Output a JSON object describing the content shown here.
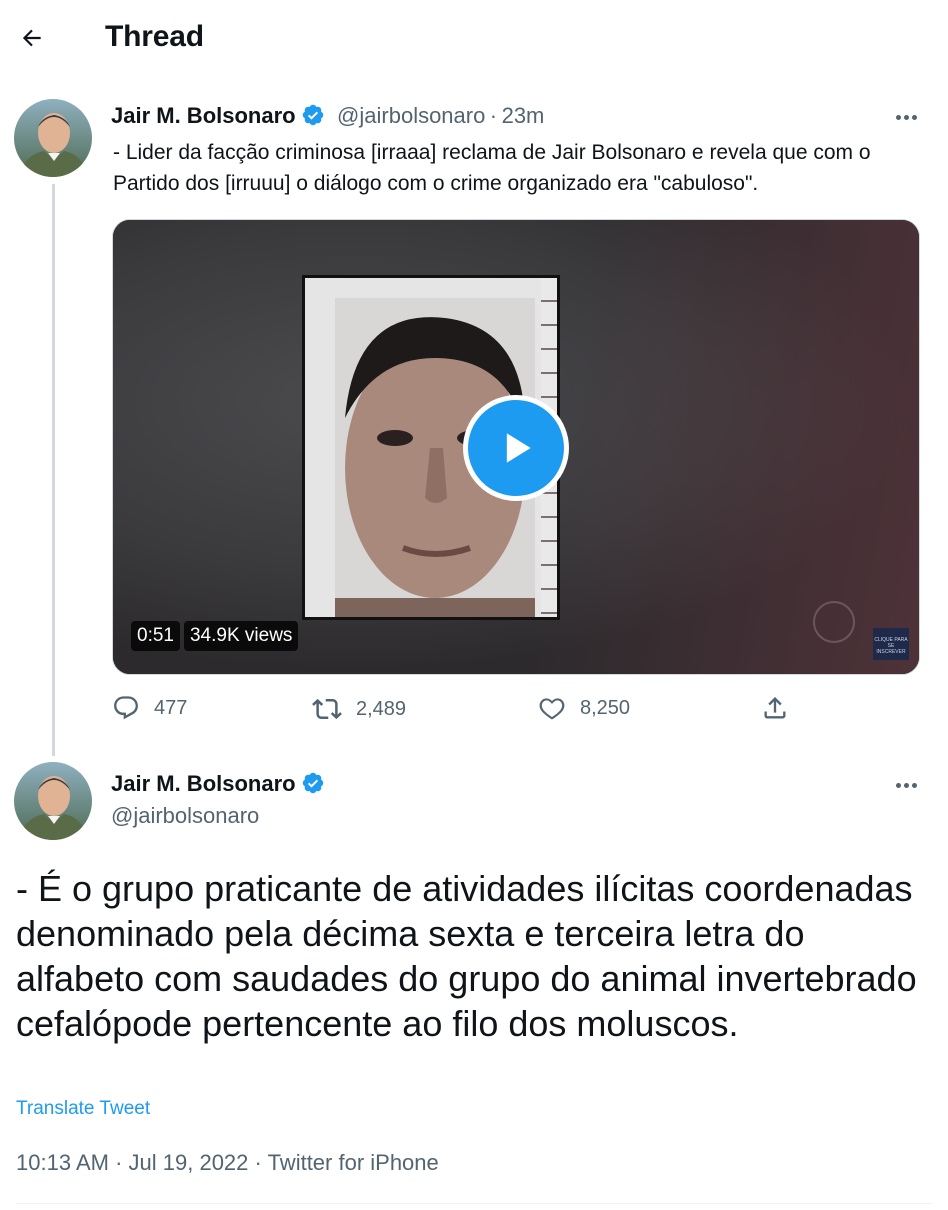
{
  "header": {
    "title": "Thread"
  },
  "tweet1": {
    "author_name": "Jair M. Bolsonaro",
    "handle": "@jairbolsonaro",
    "separator": "·",
    "time_ago": "23m",
    "text": "- Lider da facção criminosa [irraaa] reclama de Jair Bolsonaro e revela que com o Partido dos [irruuu] o diálogo com o crime organizado era \"cabuloso\".",
    "video": {
      "duration": "0:51",
      "views": "34.9K views",
      "watermark": "CLIQUE PARA SE INSCREVER"
    },
    "actions": {
      "replies": "477",
      "retweets": "2,489",
      "likes": "8,250"
    }
  },
  "tweet2": {
    "author_name": "Jair M. Bolsonaro",
    "handle": "@jairbolsonaro",
    "text": "- É o grupo praticante de atividades ilícitas coordenadas denominado pela décima sexta e terceira letra do alfabeto com saudades do grupo do animal invertebrado cefalópode pertencente ao filo dos moluscos.",
    "translate": "Translate Tweet",
    "time": "10:13 AM",
    "date": "Jul 19, 2022",
    "source": "Twitter for iPhone",
    "sep": "·"
  },
  "colors": {
    "accent": "#1d9bf0",
    "text": "#0f1419",
    "muted": "#536471",
    "thread_line": "#cfd9de"
  },
  "icons": [
    "back-arrow-icon",
    "verified-badge-icon",
    "more-icon",
    "play-icon",
    "reply-icon",
    "retweet-icon",
    "like-icon",
    "share-icon"
  ]
}
